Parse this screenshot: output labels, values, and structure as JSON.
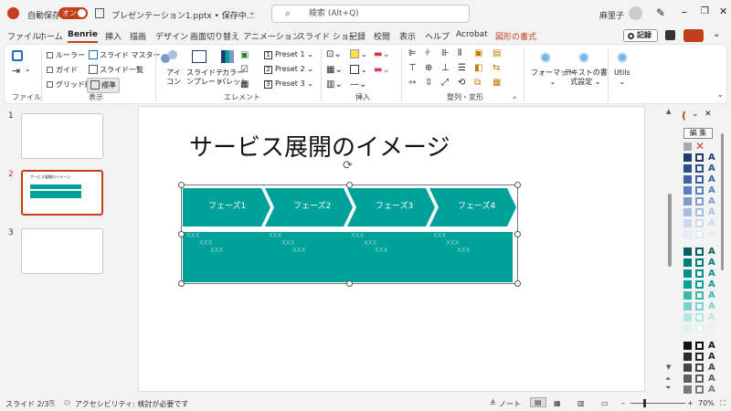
{
  "titlebar": {
    "autosave_label": "自動保存",
    "autosave_state": "オン",
    "filename": "プレゼンテーション1.pptx • 保存中...",
    "search_placeholder": "検索 (Alt+Q)",
    "user_name": "麻里子"
  },
  "tabs": [
    "ファイル",
    "ホーム",
    "Benrie",
    "挿入",
    "描画",
    "デザイン",
    "画面切り替え",
    "アニメーション",
    "スライド ショー",
    "記録",
    "校閲",
    "表示",
    "ヘルプ",
    "Acrobat",
    "図形の書式"
  ],
  "active_tab": "Benrie",
  "record_button": "記録",
  "ribbon": {
    "file_group": "ファイル",
    "view_group": "表示",
    "element_group": "エレメント",
    "insert_group": "挿入",
    "align_group": "整列・変形",
    "ruler": "ルーラー",
    "guide": "ガイド",
    "grid": "グリッド線",
    "slide_master": "スライド マスター",
    "slide_list": "スライド一覧",
    "standard": "標準",
    "icon_l1": "アイ",
    "icon_l2": "コン",
    "template_l1": "スライドテ",
    "template_l2": "ンプレート",
    "palette_l1": "カラー",
    "palette_l2": "パレット",
    "preset1": "Preset 1",
    "preset2": "Preset 2",
    "preset3": "Preset 3",
    "format": "フォーマット",
    "textset_l1": "テキストの書",
    "textset_l2": "式設定",
    "utils": "Utils"
  },
  "slides_pane": {
    "numbers": [
      "1",
      "2",
      "3"
    ],
    "thumb2_title": "サービス展開のイメージ"
  },
  "slide": {
    "title": "サービス展開のイメージ",
    "phases": [
      "フェーズ1",
      "フェーズ2",
      "フェーズ3",
      "フェーズ4"
    ],
    "placeholder": "XXX"
  },
  "right_pane": {
    "edit_button": "編 集"
  },
  "statusbar": {
    "slide_info": "スライド 2/3",
    "accessibility": "アクセシビリティ: 検討が必要です",
    "notes": "ノート",
    "zoom": "70%"
  },
  "colors": {
    "accent": "#c43e1c",
    "teal": "#00a19a",
    "navy": "#1f3a6e"
  }
}
